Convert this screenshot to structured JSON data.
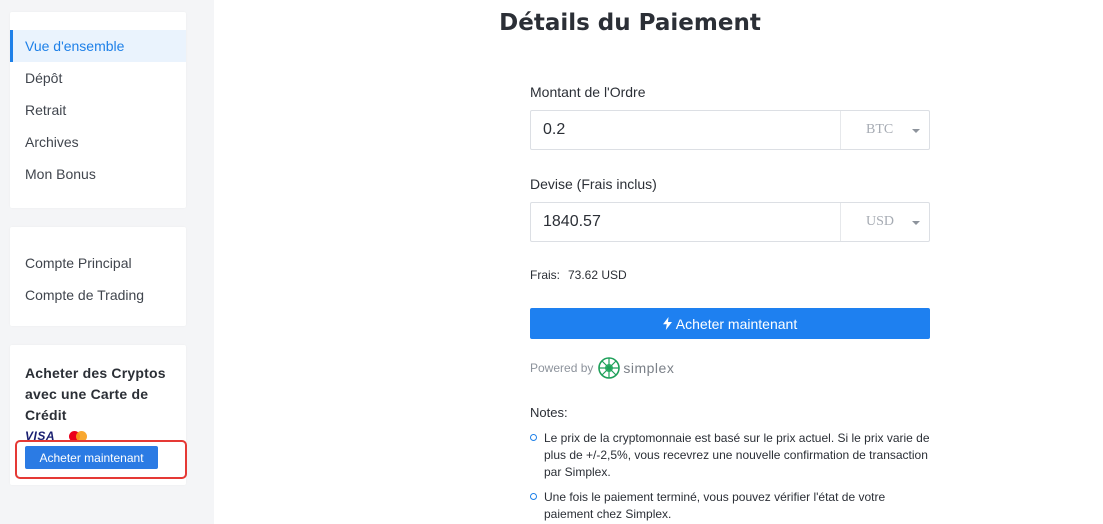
{
  "sidebar": {
    "nav": [
      {
        "label": "Vue d'ensemble",
        "active": true
      },
      {
        "label": "Dépôt"
      },
      {
        "label": "Retrait"
      },
      {
        "label": "Archives"
      },
      {
        "label": "Mon Bonus"
      }
    ],
    "accounts": [
      {
        "label": "Compte Principal"
      },
      {
        "label": "Compte de Trading"
      }
    ],
    "promo": {
      "title": "Acheter des Cryptos avec une Carte de Crédit",
      "visa_text": "VISA",
      "button_label": "Acheter maintenant"
    }
  },
  "main": {
    "title": "Détails du Paiement",
    "order_amount": {
      "label": "Montant de l'Ordre",
      "value": "0.2",
      "currency": "BTC"
    },
    "fiat": {
      "label": "Devise (Frais inclus)",
      "value": "1840.57",
      "currency": "USD"
    },
    "fee": {
      "label": "Frais:",
      "value": "73.62 USD"
    },
    "buy_button_label": "Acheter maintenant",
    "powered_by": "Powered by",
    "brand": "simplex",
    "notes_title": "Notes:",
    "notes": [
      "Le prix de la cryptomonnaie est basé sur le prix actuel. Si le prix varie de plus de +/-2,5%, vous recevrez une nouvelle confirmation de transaction par Simplex.",
      "Une fois le paiement terminé, vous pouvez vérifier l'état de votre paiement chez Simplex."
    ]
  },
  "colors": {
    "accent": "#1e80f0",
    "highlight": "#e53935",
    "sidebar_bg": "#f4f5f7"
  }
}
